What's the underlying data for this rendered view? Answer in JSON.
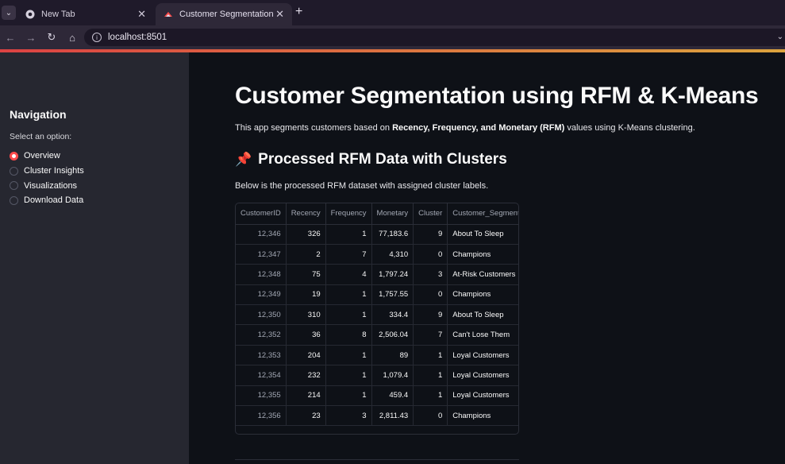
{
  "browser": {
    "tabs": [
      {
        "label": "New Tab",
        "active": false,
        "icon": "chrome-icon"
      },
      {
        "label": "Customer Segmentation",
        "active": true,
        "icon": "streamlit-icon"
      }
    ],
    "url": "localhost:8501"
  },
  "sidebar": {
    "title": "Navigation",
    "radio_label": "Select an option:",
    "options": [
      {
        "label": "Overview",
        "selected": true
      },
      {
        "label": "Cluster Insights",
        "selected": false
      },
      {
        "label": "Visualizations",
        "selected": false
      },
      {
        "label": "Download Data",
        "selected": false
      }
    ]
  },
  "main": {
    "title": "Customer Segmentation using RFM & K-Means",
    "intro_prefix": "This app segments customers based on ",
    "intro_bold": "Recency, Frequency, and Monetary (RFM)",
    "intro_suffix": " values using K-Means clustering.",
    "subheader": "Processed RFM Data with Clusters",
    "caption": "Below is the processed RFM dataset with assigned cluster labels.",
    "table": {
      "columns": [
        "CustomerID",
        "Recency",
        "Frequency",
        "Monetary",
        "Cluster",
        "Customer_Segment"
      ],
      "rows": [
        [
          "12,346",
          "326",
          "1",
          "77,183.6",
          "9",
          "About To Sleep"
        ],
        [
          "12,347",
          "2",
          "7",
          "4,310",
          "0",
          "Champions"
        ],
        [
          "12,348",
          "75",
          "4",
          "1,797.24",
          "3",
          "At-Risk Customers"
        ],
        [
          "12,349",
          "19",
          "1",
          "1,757.55",
          "0",
          "Champions"
        ],
        [
          "12,350",
          "310",
          "1",
          "334.4",
          "9",
          "About To Sleep"
        ],
        [
          "12,352",
          "36",
          "8",
          "2,506.04",
          "7",
          "Can't Lose Them"
        ],
        [
          "12,353",
          "204",
          "1",
          "89",
          "1",
          "Loyal Customers"
        ],
        [
          "12,354",
          "232",
          "1",
          "1,079.4",
          "1",
          "Loyal Customers"
        ],
        [
          "12,355",
          "214",
          "1",
          "459.4",
          "1",
          "Loyal Customers"
        ],
        [
          "12,356",
          "23",
          "3",
          "2,811.43",
          "0",
          "Champions"
        ]
      ]
    }
  },
  "colors": {
    "accent": "#ff4b4b",
    "sidebar_bg": "#262730",
    "main_bg": "#0e1117"
  }
}
